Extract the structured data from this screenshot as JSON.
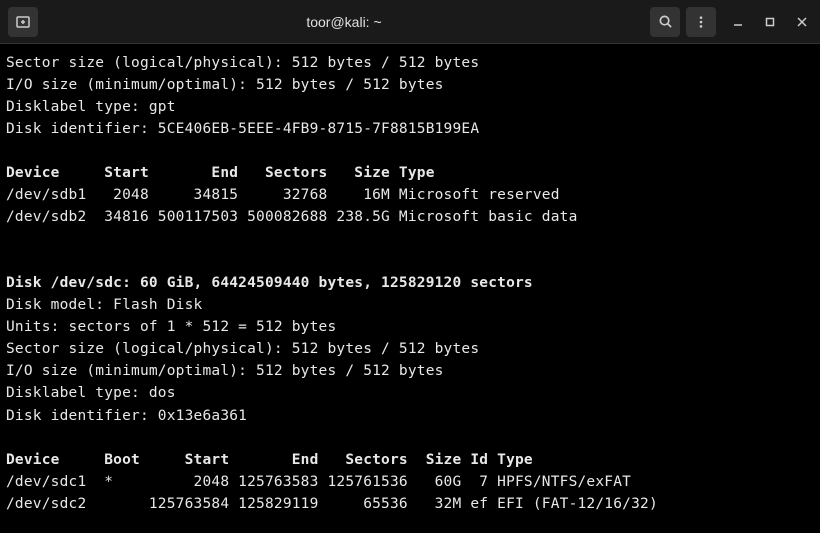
{
  "titlebar": {
    "title": "toor@kali: ~"
  },
  "terminal": {
    "disk1": {
      "sector_size": "Sector size (logical/physical): 512 bytes / 512 bytes",
      "io_size": "I/O size (minimum/optimal): 512 bytes / 512 bytes",
      "disklabel": "Disklabel type: gpt",
      "identifier": "Disk identifier: 5CE406EB-5EEE-4FB9-8715-7F8815B199EA",
      "header": "Device     Start       End   Sectors   Size Type",
      "row1": "/dev/sdb1   2048     34815     32768    16M Microsoft reserved",
      "row2": "/dev/sdb2  34816 500117503 500082688 238.5G Microsoft basic data"
    },
    "disk2": {
      "header": "Disk /dev/sdc: 60 GiB, 64424509440 bytes, 125829120 sectors",
      "model": "Disk model: Flash Disk",
      "units": "Units: sectors of 1 * 512 = 512 bytes",
      "sector_size": "Sector size (logical/physical): 512 bytes / 512 bytes",
      "io_size": "I/O size (minimum/optimal): 512 bytes / 512 bytes",
      "disklabel": "Disklabel type: dos",
      "identifier": "Disk identifier: 0x13e6a361",
      "table_header": "Device     Boot     Start       End   Sectors  Size Id Type",
      "row1": "/dev/sdc1  *         2048 125763583 125761536   60G  7 HPFS/NTFS/exFAT",
      "row2": "/dev/sdc2       125763584 125829119     65536   32M ef EFI (FAT-12/16/32)"
    }
  }
}
